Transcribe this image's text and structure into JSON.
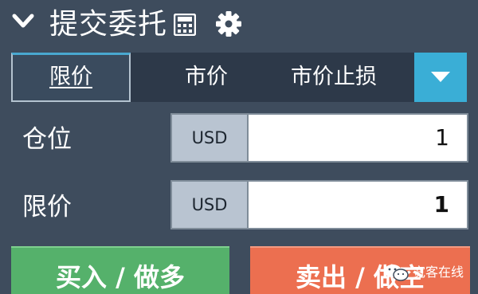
{
  "header": {
    "title": "提交委托",
    "icons": [
      "chevron-down-icon",
      "calculator-icon",
      "gear-icon"
    ]
  },
  "tabs": [
    {
      "label": "限价",
      "active": true
    },
    {
      "label": "市价",
      "active": false
    },
    {
      "label": "市价止损",
      "active": false
    }
  ],
  "form": {
    "position": {
      "label": "仓位",
      "currency": "USD",
      "value": "1"
    },
    "limit_price": {
      "label": "限价",
      "currency": "USD",
      "value": "1"
    }
  },
  "actions": {
    "buy_label": "买入 / 做多",
    "sell_label": "卖出 / 做空"
  },
  "watermark": {
    "text": "宽客在线"
  },
  "colors": {
    "background": "#3e4c5d",
    "tab_bar": "#2d3949",
    "accent": "#3aaed6",
    "buy": "#55b16b",
    "sell": "#ec6f50",
    "currency_bg": "#b9c4d1"
  }
}
